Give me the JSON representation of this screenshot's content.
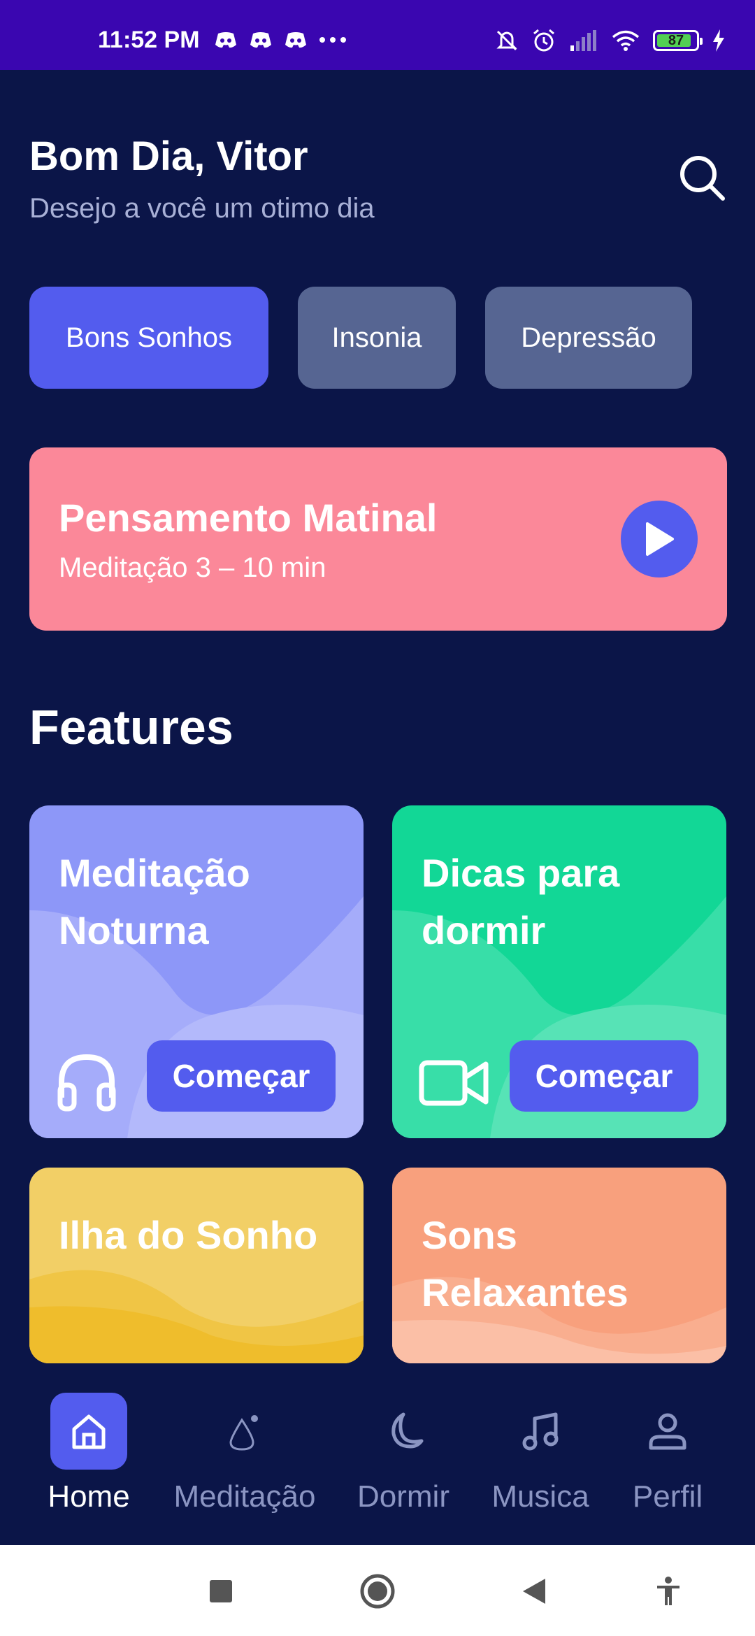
{
  "status_bar": {
    "time": "11:52 PM",
    "battery": "87",
    "icons": [
      "discord-icon",
      "discord-icon",
      "discord-icon",
      "more-dots-icon",
      "bell-off-icon",
      "alarm-icon",
      "signal-icon",
      "wifi-icon",
      "battery-icon",
      "charging-icon"
    ]
  },
  "header": {
    "greeting": "Bom Dia, Vitor",
    "subtitle": "Desejo a você um otimo dia"
  },
  "chips": [
    {
      "label": "Bons Sonhos",
      "active": true
    },
    {
      "label": "Insonia",
      "active": false
    },
    {
      "label": "Depressão",
      "active": false
    }
  ],
  "banner": {
    "title": "Pensamento Matinal",
    "subtitle": "Meditação 3 – 10 min"
  },
  "features": {
    "title": "Features",
    "cards": [
      {
        "title": "Meditação Noturna",
        "button": "Começar",
        "icon": "headphones-icon",
        "color": "#8d97f8"
      },
      {
        "title": "Dicas para dormir",
        "button": "Começar",
        "icon": "video-camera-icon",
        "color": "#12d796"
      },
      {
        "title": "Ilha do Sonho",
        "color": "#f2cf66"
      },
      {
        "title": "Sons Relaxantes",
        "color": "#f8a07d"
      }
    ]
  },
  "bottom_nav": [
    {
      "label": "Home",
      "icon": "home-icon",
      "active": true
    },
    {
      "label": "Meditação",
      "icon": "meditation-icon",
      "active": false
    },
    {
      "label": "Dormir",
      "icon": "moon-icon",
      "active": false
    },
    {
      "label": "Musica",
      "icon": "music-note-icon",
      "active": false
    },
    {
      "label": "Perfil",
      "icon": "user-icon",
      "active": false
    }
  ],
  "colors": {
    "background": "#0b1548",
    "accent": "#535cee",
    "status_bar": "#3a06b0",
    "banner": "#fb8899"
  }
}
